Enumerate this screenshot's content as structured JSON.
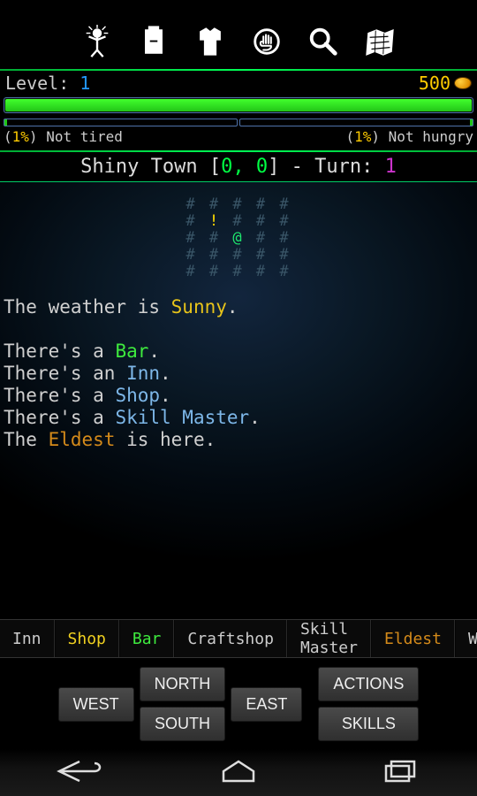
{
  "status": {
    "level_label": "Level:",
    "level": "1",
    "gold": "500",
    "tired_pct": "1%",
    "tired_text": "Not tired",
    "hungry_pct": "1%",
    "hungry_text": "Not hungry"
  },
  "location": {
    "town": "Shiny Town",
    "coords": "0, 0",
    "turn_label": "Turn:",
    "turn": "1"
  },
  "map": {
    "row1": "# # # # #",
    "row2a": "# ",
    "row2b": "!",
    "row2c": " # # #",
    "row3a": "# # ",
    "row3b": "@",
    "row3c": " # #",
    "row4": "# # # # #",
    "row5": "# # # # #"
  },
  "desc": {
    "weather_pre": "The weather is ",
    "weather_val": "Sunny",
    "l1a": "There's a ",
    "l1b": "Bar",
    "l2a": "There's an ",
    "l2b": "Inn",
    "l3a": "There's a ",
    "l3b": "Shop",
    "l4a": "There's a ",
    "l4b": "Skill Master",
    "l5a": "The ",
    "l5b": "Eldest",
    "l5c": " is here."
  },
  "quickbar": {
    "inn": "Inn",
    "shop": "Shop",
    "bar": "Bar",
    "craftshop": "Craftshop",
    "skillmaster": "Skill Master",
    "eldest": "Eldest",
    "wa": "Wa"
  },
  "dir": {
    "north": "NORTH",
    "south": "SOUTH",
    "west": "WEST",
    "east": "EAST"
  },
  "act": {
    "actions": "ACTIONS",
    "skills": "SKILLS"
  }
}
